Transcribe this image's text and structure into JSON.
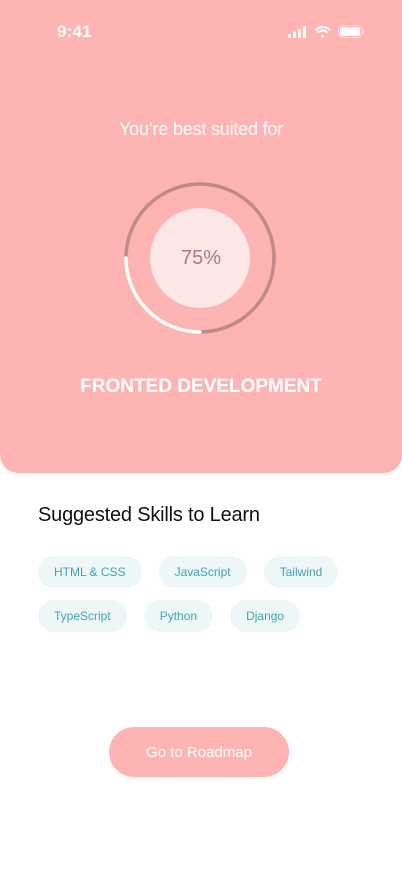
{
  "status_bar": {
    "time": "9:41",
    "icons": [
      "cellular-signal-icon",
      "wifi-icon",
      "battery-icon"
    ]
  },
  "hero": {
    "headline": "You’re best suited for",
    "progress_label": "75%",
    "progress_fraction": 0.75,
    "result": "FRONTED DEVELOPMENT"
  },
  "skills": {
    "title": "Suggested Skills to Learn",
    "row1": [
      "HTML & CSS",
      "JavaScript",
      "Tailwind"
    ],
    "row2": [
      "TypeScript",
      "Python",
      "Django"
    ]
  },
  "cta": {
    "label": "Go to Roadmap"
  },
  "colors": {
    "accent": "#ffb4b4",
    "ring": "#c08a8a",
    "ring_progress": "#ffffff",
    "chip_bg": "#eef7f8",
    "chip_text": "#42a5ae"
  }
}
